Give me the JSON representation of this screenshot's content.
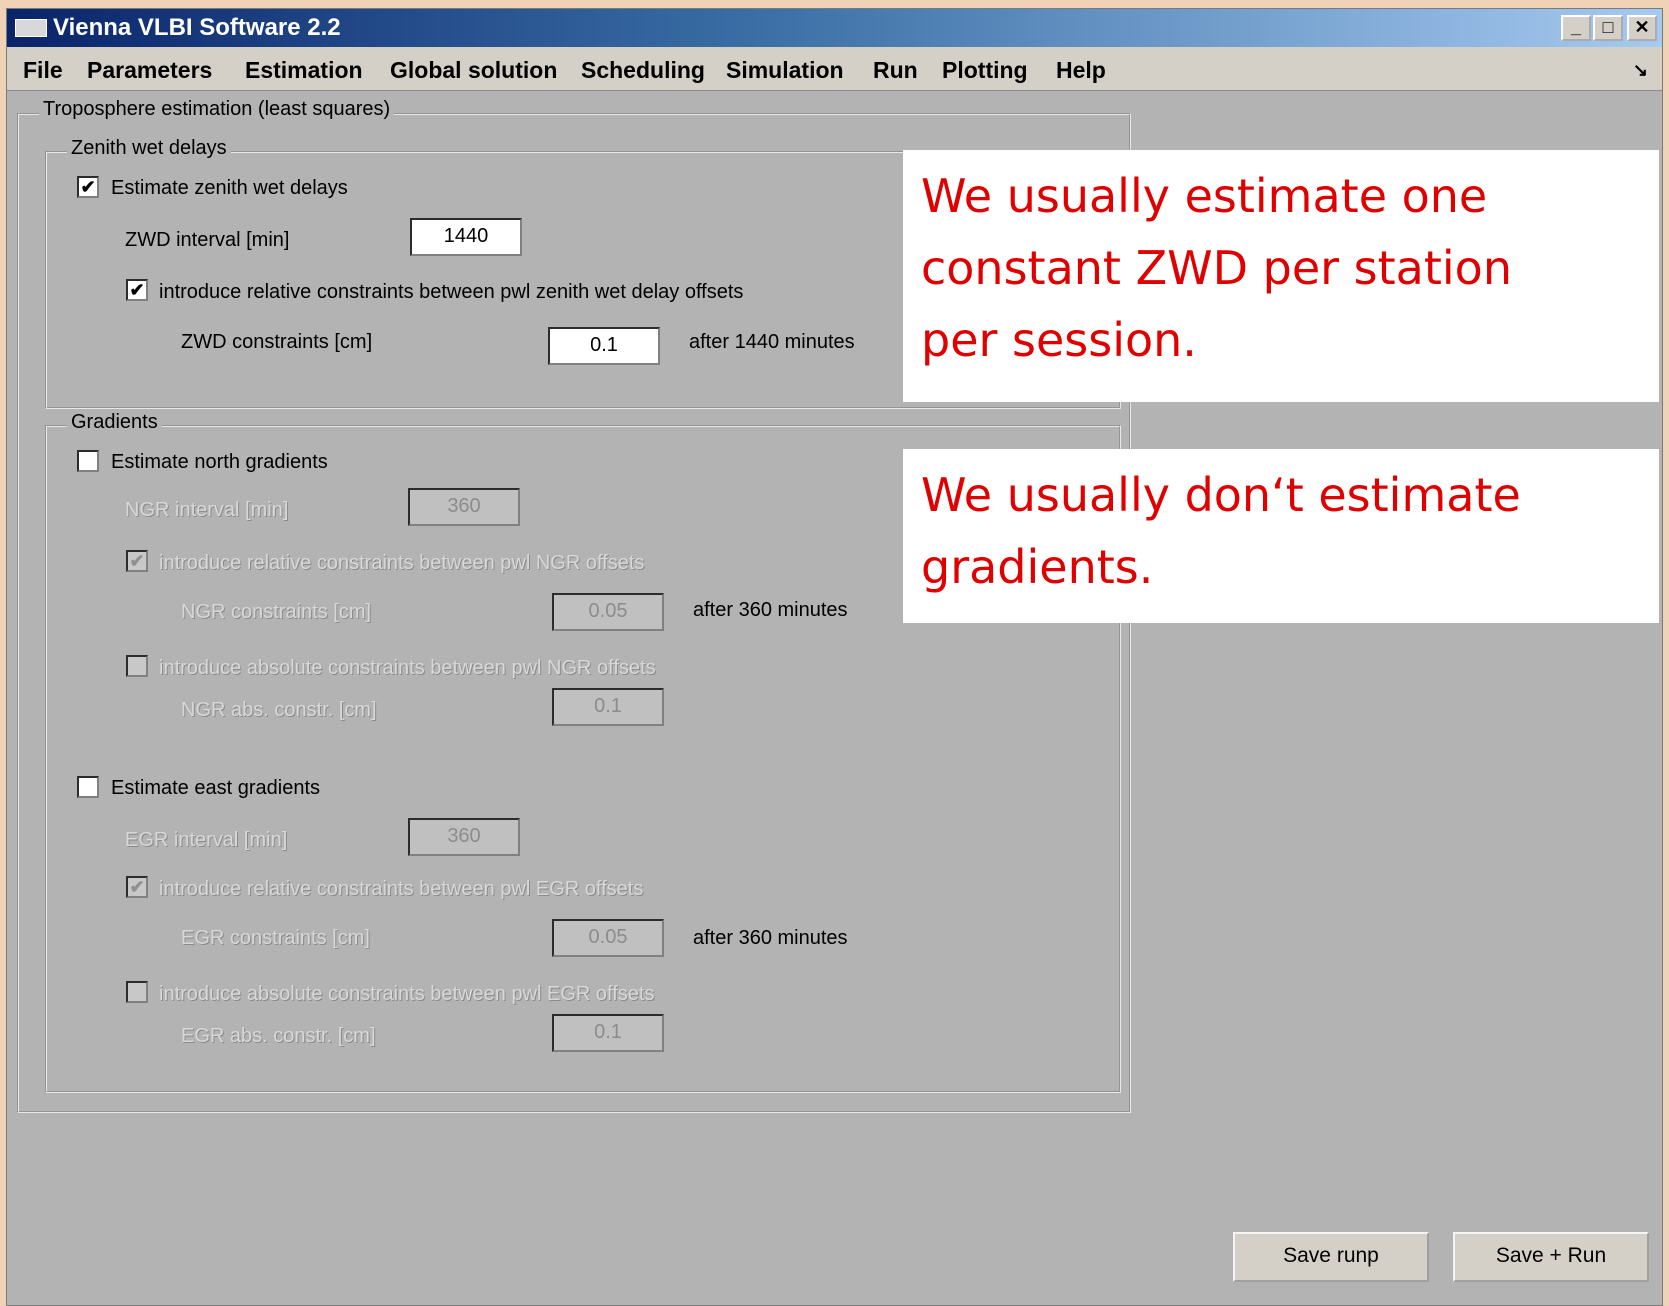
{
  "window": {
    "title": "Vienna VLBI Software 2.2",
    "controls": {
      "minimize": "_",
      "maximize": "□",
      "close": "✕"
    }
  },
  "menu": {
    "items": [
      "File",
      "Parameters",
      "Estimation",
      "Global solution",
      "Scheduling",
      "Simulation",
      "Run",
      "Plotting",
      "Help"
    ],
    "corner_glyph": "↘"
  },
  "panel": {
    "title": "Troposphere estimation (least squares)",
    "zwd": {
      "title": "Zenith wet delays",
      "estimate": {
        "label": "Estimate zenith wet delays",
        "checked": true
      },
      "interval": {
        "label": "ZWD interval [min]",
        "value": "1440"
      },
      "relative": {
        "label": "introduce relative constraints between pwl zenith wet delay offsets",
        "checked": true
      },
      "constraints": {
        "label": "ZWD constraints [cm]",
        "value": "0.1",
        "after": "after 1440 minutes"
      }
    },
    "gradients": {
      "title": "Gradients",
      "north": {
        "estimate": {
          "label": "Estimate north gradients",
          "checked": false
        },
        "interval": {
          "label": "NGR interval [min]",
          "value": "360"
        },
        "relative": {
          "label": "introduce relative constraints between pwl NGR offsets",
          "checked": true
        },
        "constraints": {
          "label": "NGR constraints [cm]",
          "value": "0.05",
          "after": "after 360 minutes"
        },
        "absolute": {
          "label": "introduce absolute constraints between pwl NGR offsets",
          "checked": false
        },
        "abs_constr": {
          "label": "NGR abs. constr. [cm]",
          "value": "0.1"
        }
      },
      "east": {
        "estimate": {
          "label": "Estimate east gradients",
          "checked": false
        },
        "interval": {
          "label": "EGR interval [min]",
          "value": "360"
        },
        "relative": {
          "label": "introduce relative constraints between pwl EGR offsets",
          "checked": true
        },
        "constraints": {
          "label": "EGR constraints [cm]",
          "value": "0.05",
          "after": "after 360 minutes"
        },
        "absolute": {
          "label": "introduce absolute constraints between pwl EGR offsets",
          "checked": false
        },
        "abs_constr": {
          "label": "EGR abs. constr. [cm]",
          "value": "0.1"
        }
      }
    }
  },
  "callouts": {
    "zwd": [
      "We usually estimate one",
      "constant ZWD per station",
      "per session."
    ],
    "gradients": [
      "We usually don‘t estimate",
      "gradients."
    ]
  },
  "buttons": {
    "save_runp": "Save runp",
    "save_run": "Save + Run"
  },
  "colors": {
    "callout_text": "#e00000",
    "window_bg": "#b3b3b3",
    "titlebar": "#0a246a"
  }
}
